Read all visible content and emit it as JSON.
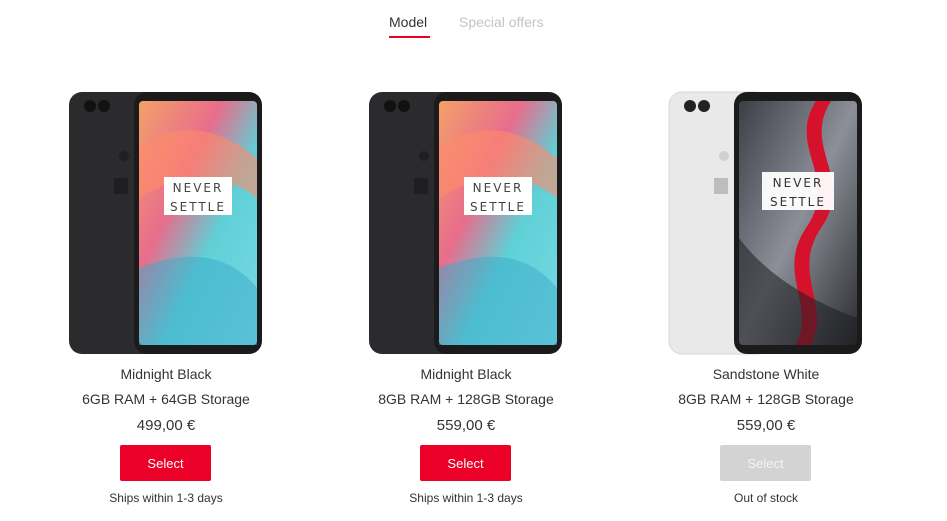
{
  "tabs": [
    {
      "label": "Model",
      "active": true
    },
    {
      "label": "Special offers",
      "active": false
    }
  ],
  "accent_color": "#eb0028",
  "products": [
    {
      "color_name": "Midnight Black",
      "spec": "6GB RAM + 64GB Storage",
      "price": "499,00 €",
      "button_label": "Select",
      "button_enabled": true,
      "shipping": "Ships within 1-3 days",
      "screen_text": [
        "NEVER",
        "SETTLE"
      ],
      "body_color": "#2b2b2d"
    },
    {
      "color_name": "Midnight Black",
      "spec": "8GB RAM + 128GB Storage",
      "price": "559,00 €",
      "button_label": "Select",
      "button_enabled": true,
      "shipping": "Ships within 1-3 days",
      "screen_text": [
        "NEVER",
        "SETTLE"
      ],
      "body_color": "#2b2b2d"
    },
    {
      "color_name": "Sandstone White",
      "spec": "8GB RAM + 128GB Storage",
      "price": "559,00 €",
      "button_label": "Select",
      "button_enabled": false,
      "shipping": "Out of stock",
      "screen_text": [
        "NEVER",
        "SETTLE"
      ],
      "body_color": "#e9e9e9"
    }
  ]
}
